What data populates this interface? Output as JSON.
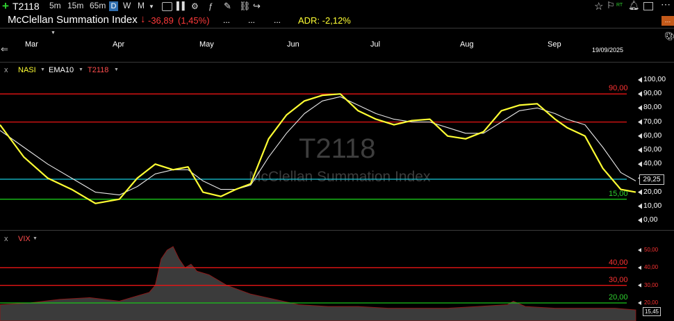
{
  "toolbar": {
    "symbol": "T2118",
    "timeframes": [
      "5m",
      "15m",
      "65m",
      "D",
      "W",
      "M"
    ],
    "active_timeframe": "D",
    "rt_label": "RT"
  },
  "header": {
    "title": "McClellan Summation Index",
    "change": "-36,89",
    "change_pct": "(1,45%)",
    "dots": [
      "...",
      "...",
      "..."
    ],
    "adr": "ADR: -2,12%",
    "date": "19/09/2025"
  },
  "months": [
    "Mar",
    "Apr",
    "May",
    "Jun",
    "Jul",
    "Aug",
    "Sep"
  ],
  "main_legend": {
    "close": "x",
    "items": [
      "NASI",
      "EMA10",
      "T2118"
    ]
  },
  "vix_legend": {
    "close": "x",
    "item": "VIX"
  },
  "watermark": {
    "symbol": "T2118",
    "name": "McClellan Summation Index"
  },
  "colors": {
    "nasi": "#ffff33",
    "ema": "#e8e8e8",
    "red_level": "#e81515",
    "green_level": "#19c619",
    "cyan_level": "#16b9c9",
    "vix_fill": "#3b3b3b"
  },
  "chart_data": [
    {
      "type": "line",
      "title": "McClellan Summation Index",
      "ylim": [
        0,
        100
      ],
      "yticks": [
        "100,00",
        "90,00",
        "80,00",
        "70,00",
        "60,00",
        "50,00",
        "40,00",
        "30,00",
        "20,00",
        "10,00",
        "0,00"
      ],
      "x_labels": [
        "Mar",
        "Apr",
        "May",
        "Jun",
        "Jul",
        "Aug",
        "Sep"
      ],
      "x_range_days": [
        0,
        210
      ],
      "levels": [
        {
          "value": 90,
          "label": "90,00",
          "color": "red"
        },
        {
          "value": 70,
          "label": "",
          "color": "red"
        },
        {
          "value": 29.25,
          "label": "",
          "color": "cyan"
        },
        {
          "value": 15,
          "label": "15,00",
          "color": "green"
        }
      ],
      "last_value": "29,25",
      "grid": false,
      "series": [
        {
          "name": "NASI",
          "x": [
            0,
            8,
            16,
            24,
            32,
            40,
            46,
            52,
            58,
            63,
            68,
            74,
            79,
            84,
            90,
            96,
            102,
            108,
            114,
            120,
            126,
            132,
            138,
            144,
            150,
            156,
            162,
            168,
            174,
            180,
            186,
            190,
            196,
            202,
            208,
            213
          ],
          "y": [
            68,
            45,
            30,
            22,
            12,
            15,
            30,
            40,
            36,
            38,
            20,
            17,
            22,
            26,
            58,
            75,
            85,
            89,
            90,
            78,
            72,
            68,
            71,
            72,
            60,
            58,
            63,
            78,
            82,
            83,
            72,
            66,
            60,
            37,
            22,
            20
          ]
        },
        {
          "name": "EMA10",
          "x": [
            0,
            8,
            16,
            24,
            32,
            40,
            46,
            52,
            58,
            63,
            68,
            74,
            79,
            84,
            90,
            96,
            102,
            108,
            114,
            120,
            126,
            132,
            138,
            144,
            150,
            156,
            162,
            168,
            174,
            180,
            186,
            190,
            196,
            202,
            208,
            213
          ],
          "y": [
            64,
            52,
            40,
            30,
            20,
            18,
            24,
            33,
            36,
            36,
            28,
            22,
            22,
            25,
            45,
            62,
            76,
            85,
            88,
            82,
            76,
            72,
            70,
            70,
            66,
            62,
            62,
            70,
            78,
            80,
            76,
            72,
            68,
            52,
            34,
            28
          ]
        }
      ]
    },
    {
      "type": "area",
      "title": "VIX",
      "ylim": [
        15,
        55
      ],
      "yticks": [
        "50,00",
        "40,00",
        "30,00",
        "20,00"
      ],
      "levels": [
        {
          "value": 40,
          "label": "40,00",
          "color": "red"
        },
        {
          "value": 30,
          "label": "30,00",
          "color": "red"
        },
        {
          "value": 20,
          "label": "20,00",
          "color": "green"
        }
      ],
      "last_value": "15,45",
      "grid": false,
      "series": [
        {
          "name": "VIX",
          "x": [
            0,
            10,
            20,
            30,
            40,
            46,
            50,
            52,
            54,
            56,
            58,
            60,
            62,
            64,
            66,
            70,
            76,
            84,
            92,
            100,
            110,
            120,
            130,
            140,
            150,
            160,
            170,
            172,
            176,
            186,
            196,
            206,
            213
          ],
          "y": [
            19,
            20,
            22,
            23,
            21,
            24,
            26,
            30,
            45,
            50,
            52,
            45,
            40,
            42,
            38,
            36,
            30,
            25,
            22,
            19,
            18,
            18,
            17,
            17,
            17,
            18,
            19,
            21,
            18,
            17,
            17,
            17,
            16
          ]
        }
      ]
    }
  ]
}
